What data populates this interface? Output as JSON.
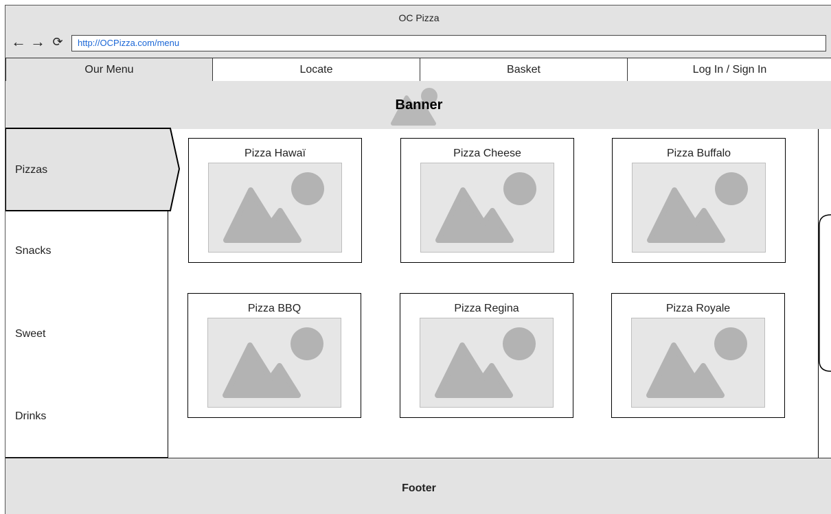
{
  "window": {
    "title": "OC Pizza"
  },
  "browser": {
    "url": "http://OCPizza.com/menu",
    "icons": [
      "back-arrow-icon",
      "forward-arrow-icon",
      "reload-icon"
    ]
  },
  "nav": {
    "tabs": [
      {
        "label": "Our Menu",
        "active": true
      },
      {
        "label": "Locate"
      },
      {
        "label": "Basket"
      },
      {
        "label": "Log In / Sign In"
      }
    ]
  },
  "banner": {
    "label": "Banner"
  },
  "sidebar": {
    "items": [
      {
        "label": "Pizzas",
        "active": true
      },
      {
        "label": "Snacks"
      },
      {
        "label": "Sweet"
      },
      {
        "label": "Drinks"
      }
    ]
  },
  "products": [
    {
      "name": "Pizza Hawaï"
    },
    {
      "name": "Pizza Cheese"
    },
    {
      "name": "Pizza Buffalo"
    },
    {
      "name": "Pizza BBQ"
    },
    {
      "name": "Pizza Regina"
    },
    {
      "name": "Pizza Royale"
    }
  ],
  "footer": {
    "label": "Footer"
  },
  "colors": {
    "panel": "#e3e3e3",
    "url": "#1a66d6",
    "placeholder": "#b3b3b3"
  }
}
